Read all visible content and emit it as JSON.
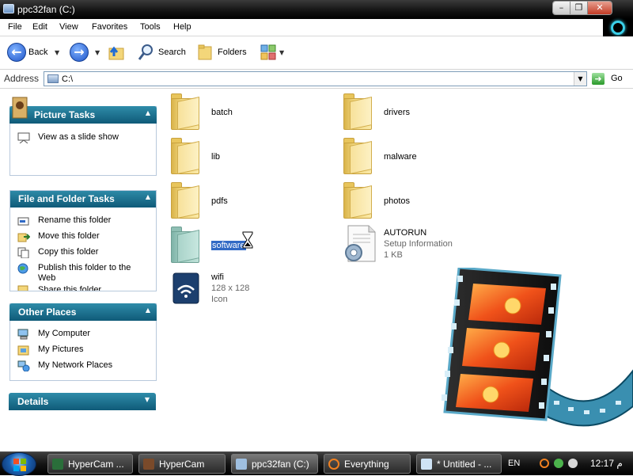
{
  "window": {
    "title": "ppc32fan (C:)",
    "caption_buttons": [
      "minimize-icon",
      "restore-icon",
      "close-icon"
    ]
  },
  "menu": {
    "items": [
      "File",
      "Edit",
      "View",
      "Favorites",
      "Tools",
      "Help"
    ]
  },
  "toolbar": {
    "back_label": "Back",
    "search_label": "Search",
    "folders_label": "Folders"
  },
  "address": {
    "label": "Address",
    "value": "C:\\",
    "go_label": "Go"
  },
  "sidebar": {
    "panels": [
      {
        "title": "Picture Tasks",
        "items": [
          {
            "label": "View as a slide show",
            "icon": "slideshow-icon"
          }
        ]
      },
      {
        "title": "File and Folder Tasks",
        "items": [
          {
            "label": "Rename this folder",
            "icon": "rename-icon"
          },
          {
            "label": "Move this folder",
            "icon": "move-icon"
          },
          {
            "label": "Copy this folder",
            "icon": "copy-icon"
          },
          {
            "label": "Publish this folder to the Web",
            "icon": "globe-icon"
          },
          {
            "label": "Share this folder",
            "icon": "share-icon"
          }
        ]
      },
      {
        "title": "Other Places",
        "items": [
          {
            "label": "My Computer",
            "icon": "computer-icon"
          },
          {
            "label": "My Pictures",
            "icon": "pictures-icon"
          },
          {
            "label": "My Network Places",
            "icon": "network-icon"
          }
        ]
      },
      {
        "title": "Details",
        "items": []
      }
    ]
  },
  "files": [
    {
      "name": "batch",
      "type": "folder"
    },
    {
      "name": "drivers",
      "type": "folder"
    },
    {
      "name": "lib",
      "type": "folder"
    },
    {
      "name": "malware",
      "type": "folder"
    },
    {
      "name": "pdfs",
      "type": "folder"
    },
    {
      "name": "photos",
      "type": "folder"
    },
    {
      "name": "software",
      "type": "folder",
      "selected": true
    },
    {
      "name": "AUTORUN",
      "type": "file",
      "detail1": "Setup Information",
      "detail2": "1 KB"
    },
    {
      "name": "wifi",
      "type": "icon-file",
      "detail1": "128 x 128",
      "detail2": "Icon"
    }
  ],
  "taskbar": {
    "buttons": [
      {
        "label": "HyperCam ...",
        "icon": "hypercam-icon"
      },
      {
        "label": "HyperCam",
        "icon": "hypercam-icon"
      },
      {
        "label": "ppc32fan (C:)",
        "icon": "drive-icon"
      },
      {
        "label": "Everything",
        "icon": "search-icon"
      },
      {
        "label": "* Untitled - ...",
        "icon": "notepad-icon"
      }
    ],
    "language": "EN",
    "clock": "12:17 م"
  },
  "colors": {
    "panel_header": "#1f7596",
    "selection": "#316ac5",
    "taskbar": "#1b1b1b"
  }
}
